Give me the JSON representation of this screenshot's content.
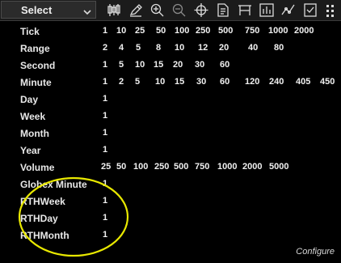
{
  "toolbar": {
    "select_label": "Select",
    "icons": [
      "bar-chart-icon",
      "pencil-icon",
      "zoom-in-icon",
      "zoom-out-icon",
      "crosshair-icon",
      "properties-icon",
      "range-icon",
      "histogram-icon",
      "indicator-icon",
      "strategy-icon",
      "more-icon"
    ]
  },
  "rows": [
    {
      "label": "Tick",
      "values": [
        "1",
        "10",
        "25",
        "50",
        "100",
        "250",
        "500",
        "750",
        "1000",
        "2000"
      ]
    },
    {
      "label": "Range",
      "values": [
        "2",
        "4",
        "5",
        "8",
        "10",
        "12",
        "20",
        "40",
        "80"
      ]
    },
    {
      "label": "Second",
      "values": [
        "1",
        "5",
        "10",
        "15",
        "20",
        "30",
        "60"
      ]
    },
    {
      "label": "Minute",
      "values": [
        "1",
        "2",
        "5",
        "10",
        "15",
        "30",
        "60",
        "120",
        "240",
        "405",
        "450"
      ]
    },
    {
      "label": "Day",
      "values": [
        "1"
      ]
    },
    {
      "label": "Week",
      "values": [
        "1"
      ]
    },
    {
      "label": "Month",
      "values": [
        "1"
      ]
    },
    {
      "label": "Year",
      "values": [
        "1"
      ]
    },
    {
      "label": "Volume",
      "values": [
        "25",
        "50",
        "100",
        "250",
        "500",
        "750",
        "1000",
        "2000",
        "5000"
      ]
    },
    {
      "label": "Globex Minute",
      "values": [
        "1"
      ]
    },
    {
      "label": "RTHWeek",
      "values": [
        "1"
      ]
    },
    {
      "label": "RTHDay",
      "values": [
        "1"
      ]
    },
    {
      "label": "RTHMonth",
      "values": [
        "1"
      ]
    }
  ],
  "footer": {
    "configure_label": "Configure"
  },
  "colors": {
    "background": "#000000",
    "toolbar": "#1b1b1b",
    "highlight_circle": "#e8e800"
  }
}
